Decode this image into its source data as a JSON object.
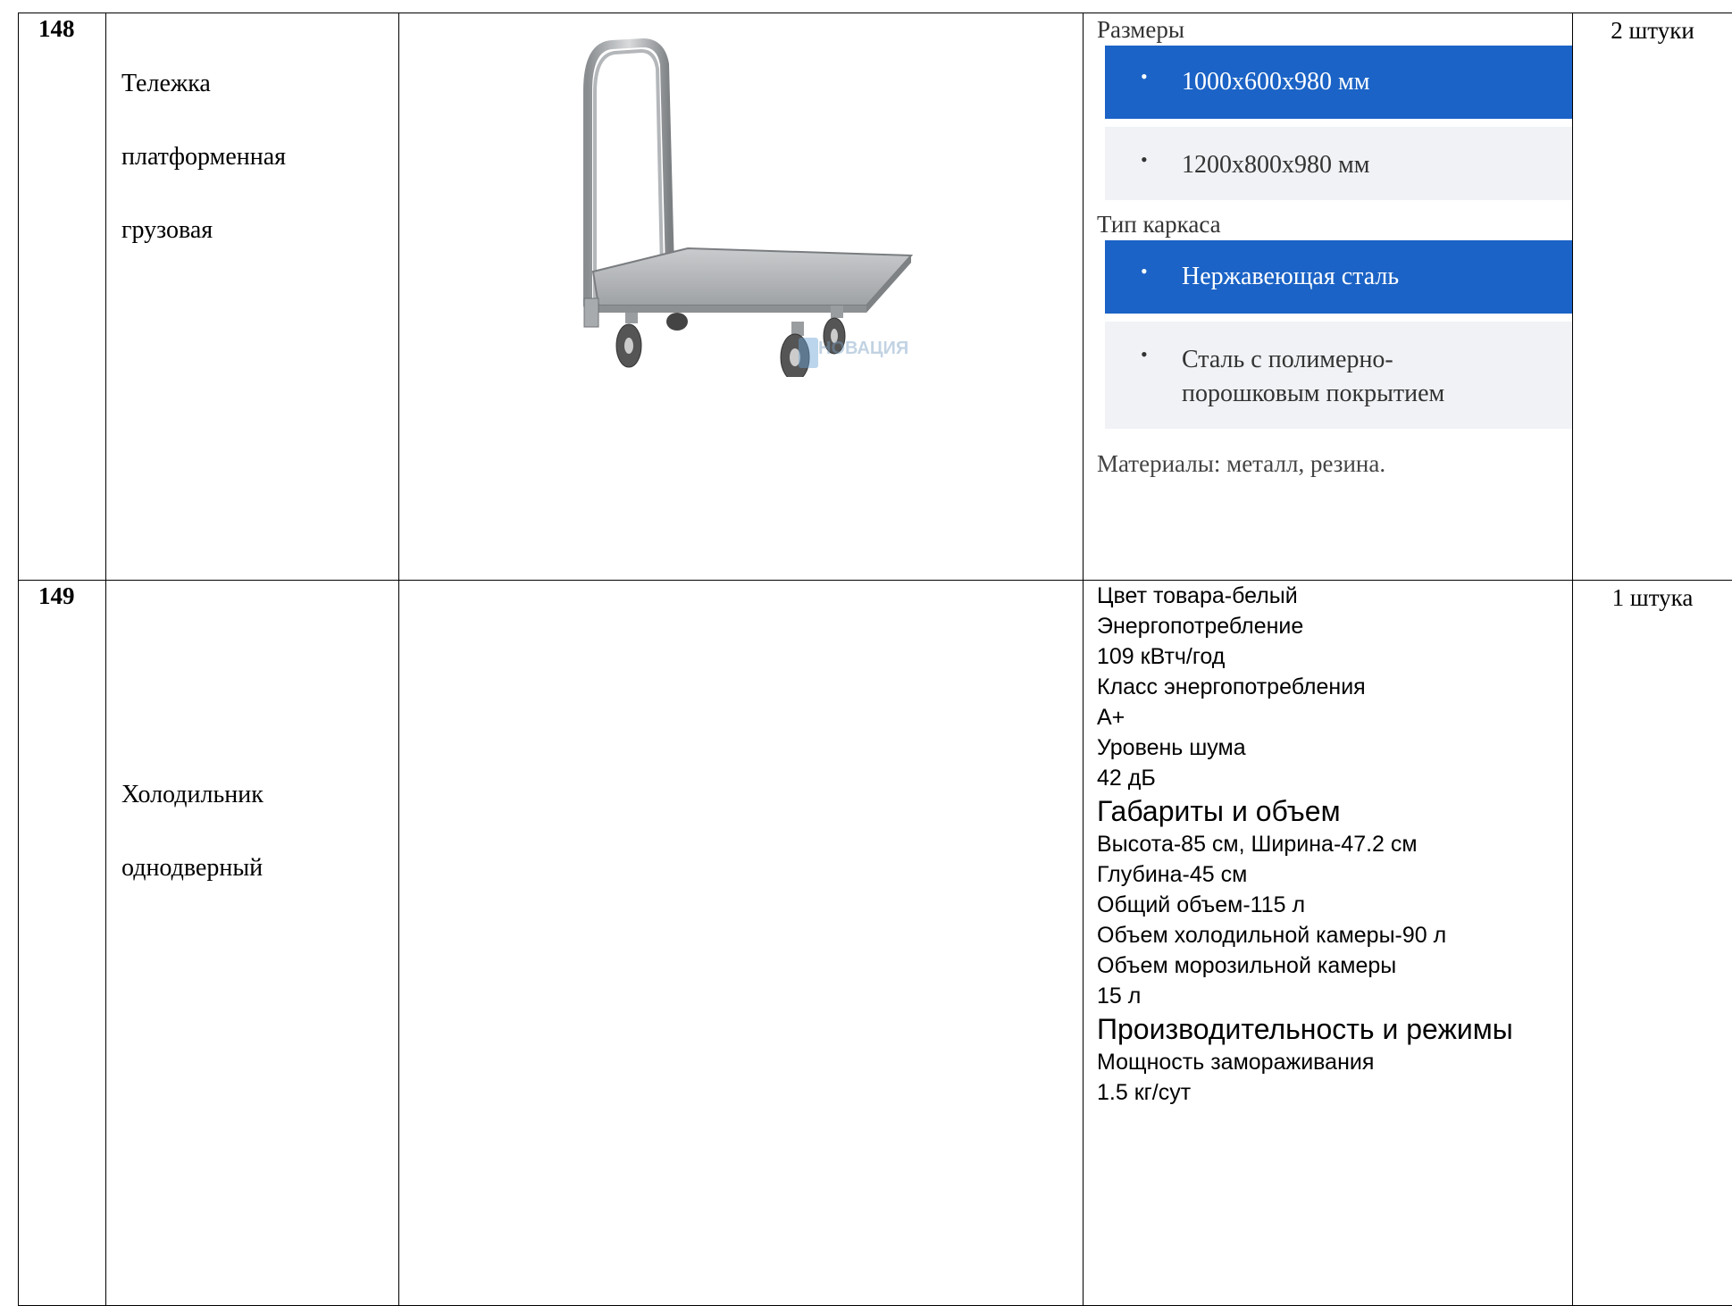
{
  "rows": [
    {
      "number": "148",
      "name_lines": [
        "Тележка",
        "платформенная",
        "грузовая"
      ],
      "description": {
        "sizes_label": "Размеры",
        "sizes": [
          "1000х600х980 мм",
          "1200х800х980 мм"
        ],
        "frame_label": "Тип каркаса",
        "frames": [
          "Нержавеющая сталь",
          "Сталь с полимерно-",
          "порошковым покрытием"
        ],
        "materials": "Материалы: металл, резина."
      },
      "quantity": "2 штуки",
      "image": {
        "watermark": "НОВАЦИЯ"
      }
    },
    {
      "number": "149",
      "name_lines": [
        "Холодильник",
        "однодверный"
      ],
      "description_lines": [
        "Цвет товара-белый",
        "Энергопотребление",
        "109 кВтч/год",
        "Класс энергопотребления",
        "А+",
        "Уровень шума",
        "42 дБ",
        "Габариты и объем",
        "Высота-85 см, Ширина-47.2 см",
        "Глубина-45 см",
        "Общий объем-115 л",
        "Объем холодильной камеры-90 л",
        "Объем морозильной камеры",
        "15 л",
        "Производительность и режимы",
        "Мощность замораживания",
        "1.5 кг/сут"
      ],
      "quantity": "1 штука"
    }
  ],
  "colors": {
    "option_active": "#1b63c6",
    "option_inactive": "#f0f2f5",
    "border": "#000000"
  }
}
